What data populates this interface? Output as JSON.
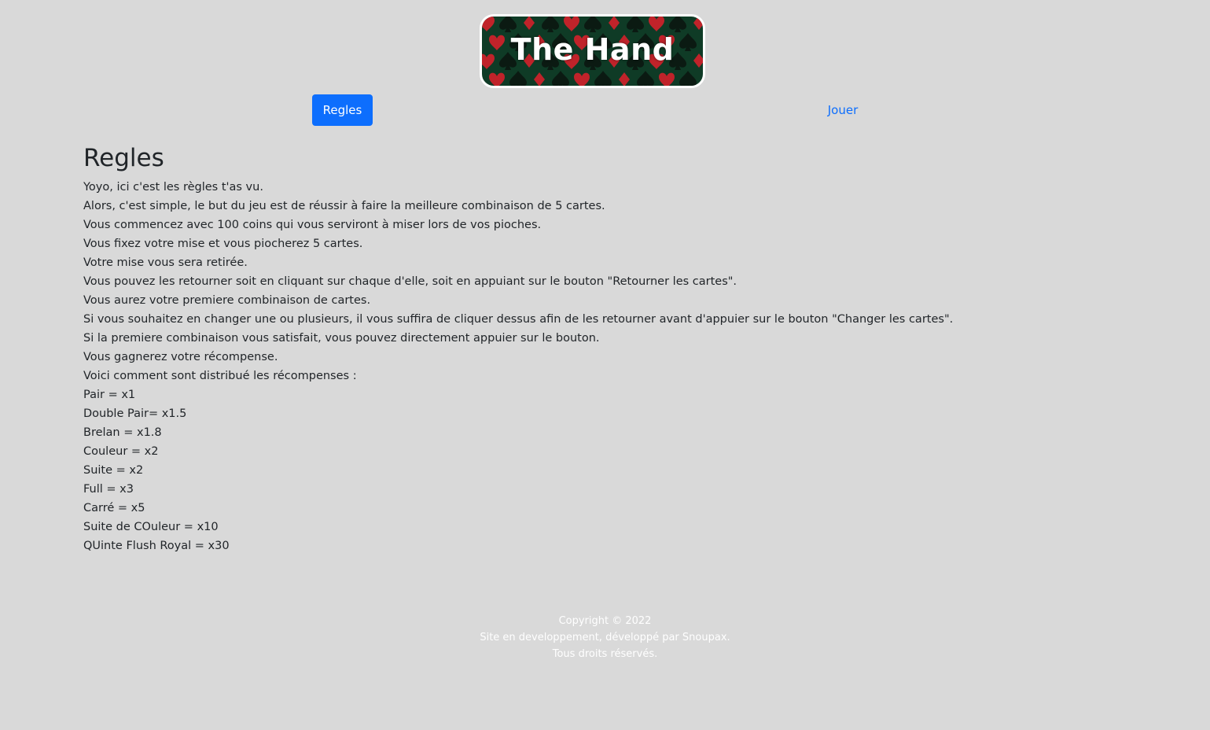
{
  "header": {
    "logo_title": "The Hand",
    "colors": {
      "logo_background": "#0f3b26",
      "heart_red": "#c0232a",
      "spade_dark": "#0b1a12"
    }
  },
  "nav": {
    "rules_label": "Regles",
    "play_label": "Jouer",
    "active_color": "#0d6efd"
  },
  "main": {
    "title": "Regles",
    "lines": [
      "Yoyo, ici c'est les règles t'as vu.",
      "Alors, c'est simple, le but du jeu est de réussir à faire la meilleure combinaison de 5 cartes.",
      "Vous commencez avec 100 coins qui vous serviront à miser lors de vos pioches.",
      "Vous fixez votre mise et vous piocherez 5 cartes.",
      "Votre mise vous sera retirée.",
      "Vous pouvez les retourner soit en cliquant sur chaque d'elle, soit en appuiant sur le bouton \"Retourner les cartes\".",
      "Vous aurez votre premiere combinaison de cartes.",
      "Si vous souhaitez en changer une ou plusieurs, il vous suffira de cliquer dessus afin de les retourner avant d'appuier sur le bouton \"Changer les cartes\".",
      "Si la premiere combinaison vous satisfait, vous pouvez directement appuier sur le bouton.",
      "Vous gagnerez votre récompense.",
      "Voici comment sont distribué les récompenses :",
      "Pair = x1",
      "Double Pair= x1.5",
      "Brelan = x1.8",
      "Couleur = x2",
      "Suite = x2",
      "Full = x3",
      "Carré = x5",
      "Suite de COuleur = x10",
      "QUinte Flush Royal = x30"
    ]
  },
  "footer": {
    "copyright": "Copyright © 2022",
    "credit": "Site en developpement, développé par Snoupax.",
    "rights": "Tous droits réservés."
  }
}
